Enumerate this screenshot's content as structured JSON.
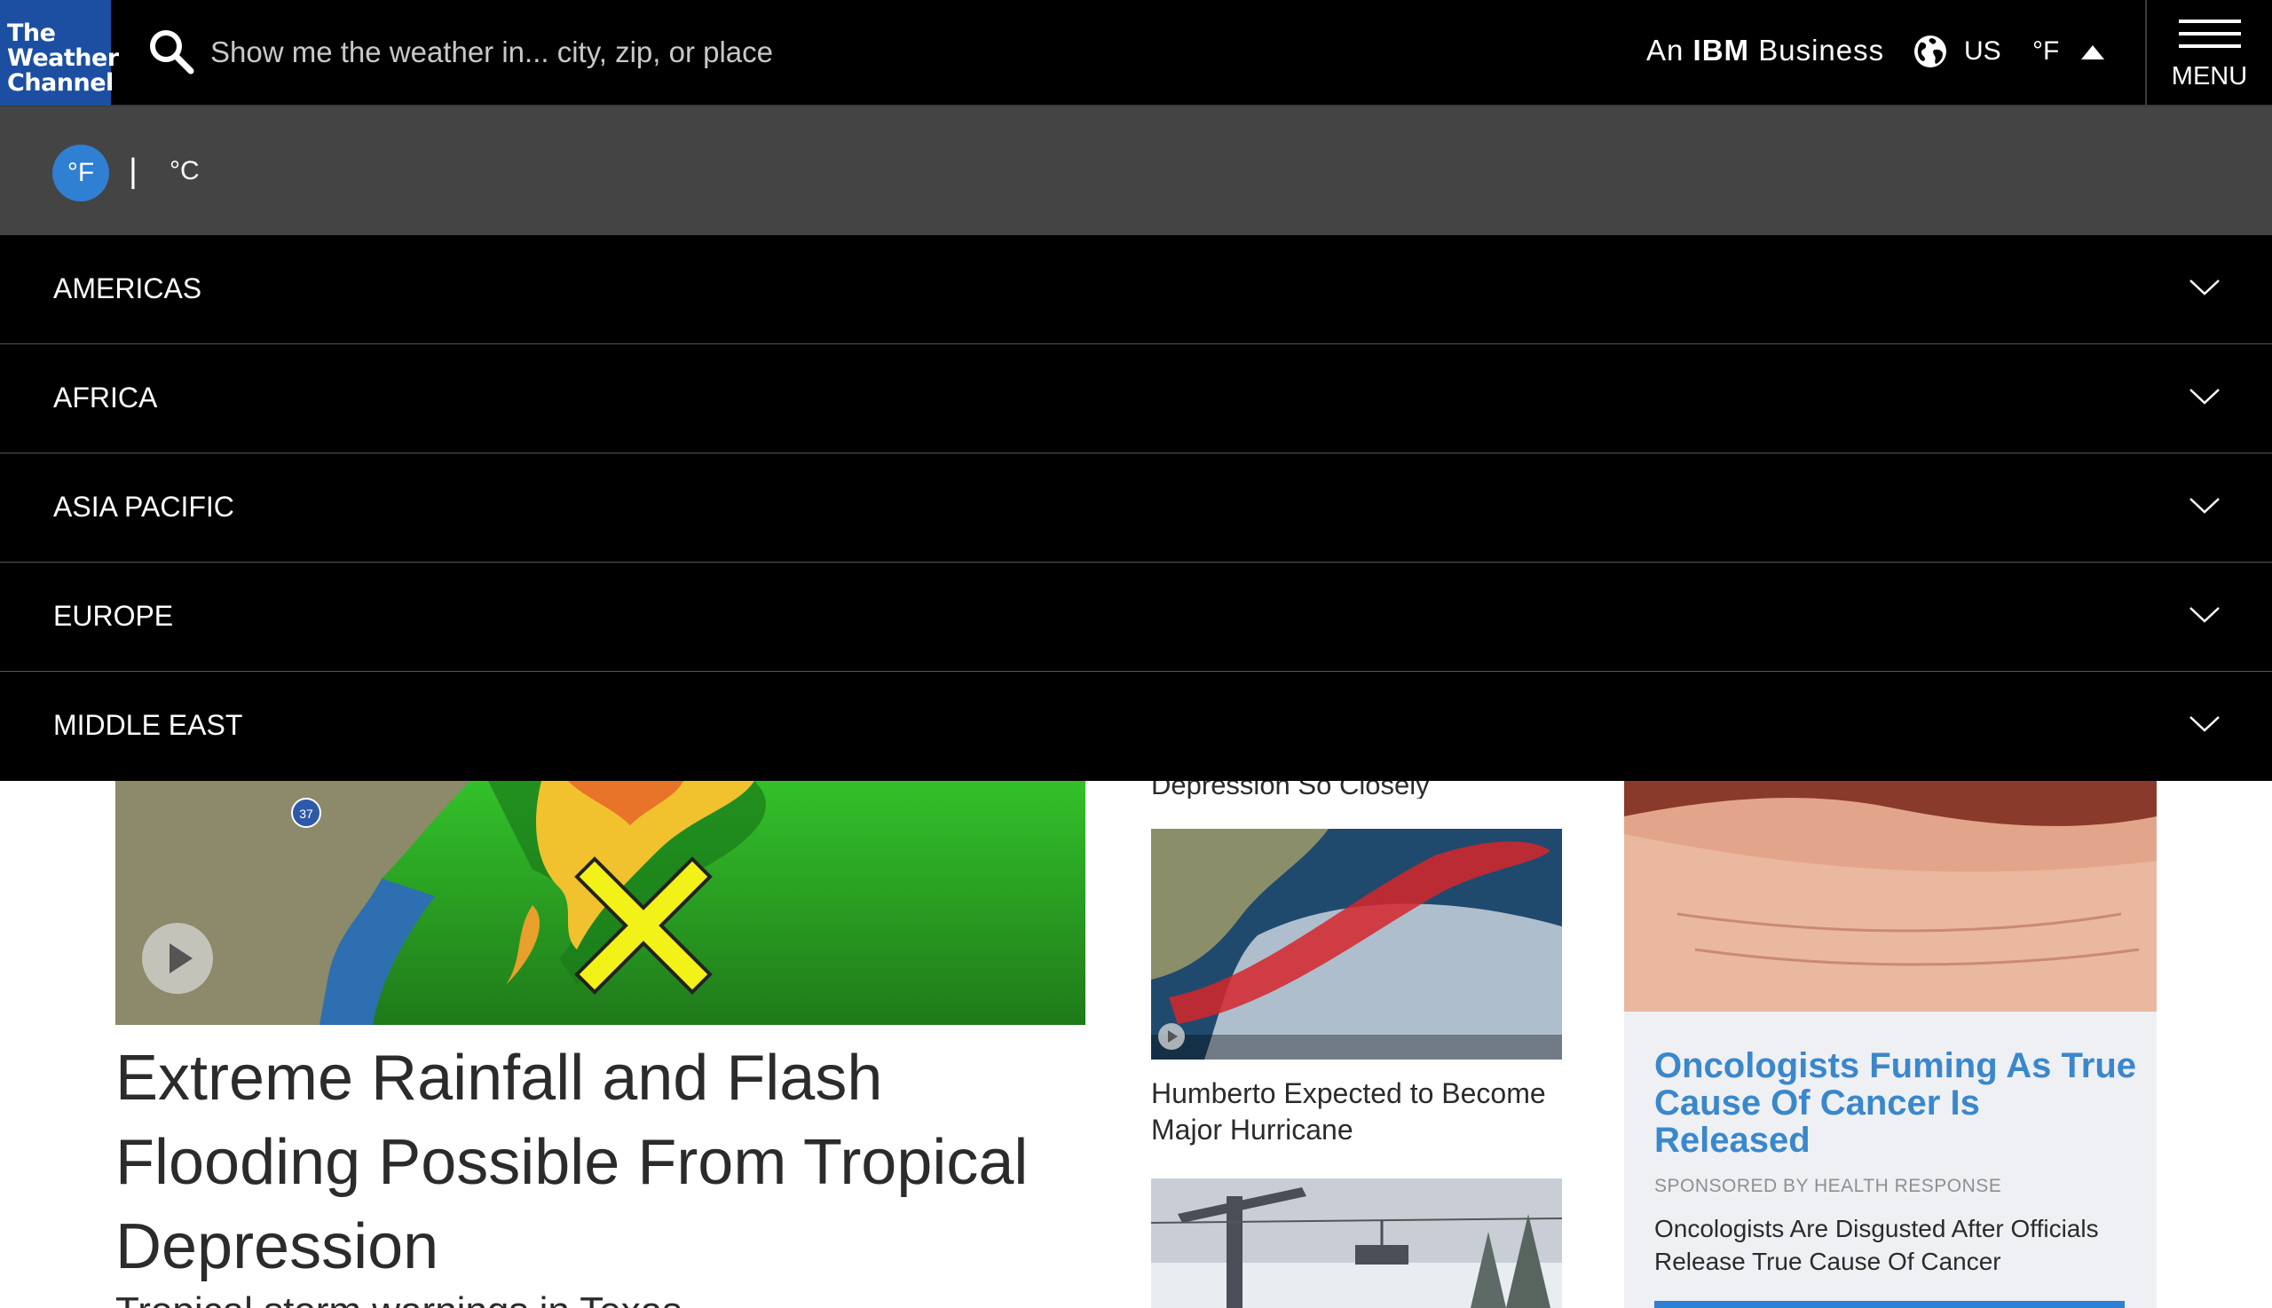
{
  "header": {
    "logo_lines": [
      "The",
      "Weather",
      "Channel"
    ],
    "search_placeholder": "Show me the weather in... city, zip, or place",
    "ibm_prefix": "An",
    "ibm_brand": "IBM",
    "ibm_suffix": "Business",
    "region": "US",
    "unit": "°F",
    "menu_label": "MENU",
    "icons": {
      "search": "search-icon",
      "globe": "globe-icon",
      "collapse": "caret-up-icon",
      "menu": "hamburger-icon"
    }
  },
  "unit_selector": {
    "fahrenheit": "°F",
    "separator": "|",
    "celsius": "°C",
    "selected": "°F",
    "selected_color": "#2f7fd3"
  },
  "regions": [
    {
      "label": "AMERICAS"
    },
    {
      "label": "AFRICA"
    },
    {
      "label": "ASIA PACIFIC"
    },
    {
      "label": "EUROPE"
    },
    {
      "label": "MIDDLE EAST"
    }
  ],
  "content": {
    "main_headline": "Extreme Rainfall and Flash Flooding Possible From Tropical Depression",
    "main_subtext": "Tropical storm warnings in Texas",
    "mid_cut_text": "Depression So Closely",
    "mid_headline": "Humberto Expected to Become Major Hurricane",
    "map_shield": "37",
    "ad": {
      "title": "Oncologists Fuming As True Cause Of Cancer Is Released",
      "sponsor": "SPONSORED BY HEALTH RESPONSE",
      "description": "Oncologists Are Disgusted After Officials Release True Cause Of Cancer",
      "title_color": "#3a87cc"
    }
  },
  "colors": {
    "brand": "#1c4fa1",
    "header_bg": "#000000",
    "unit_bar_bg": "#444444",
    "accent": "#2f7fd3"
  }
}
